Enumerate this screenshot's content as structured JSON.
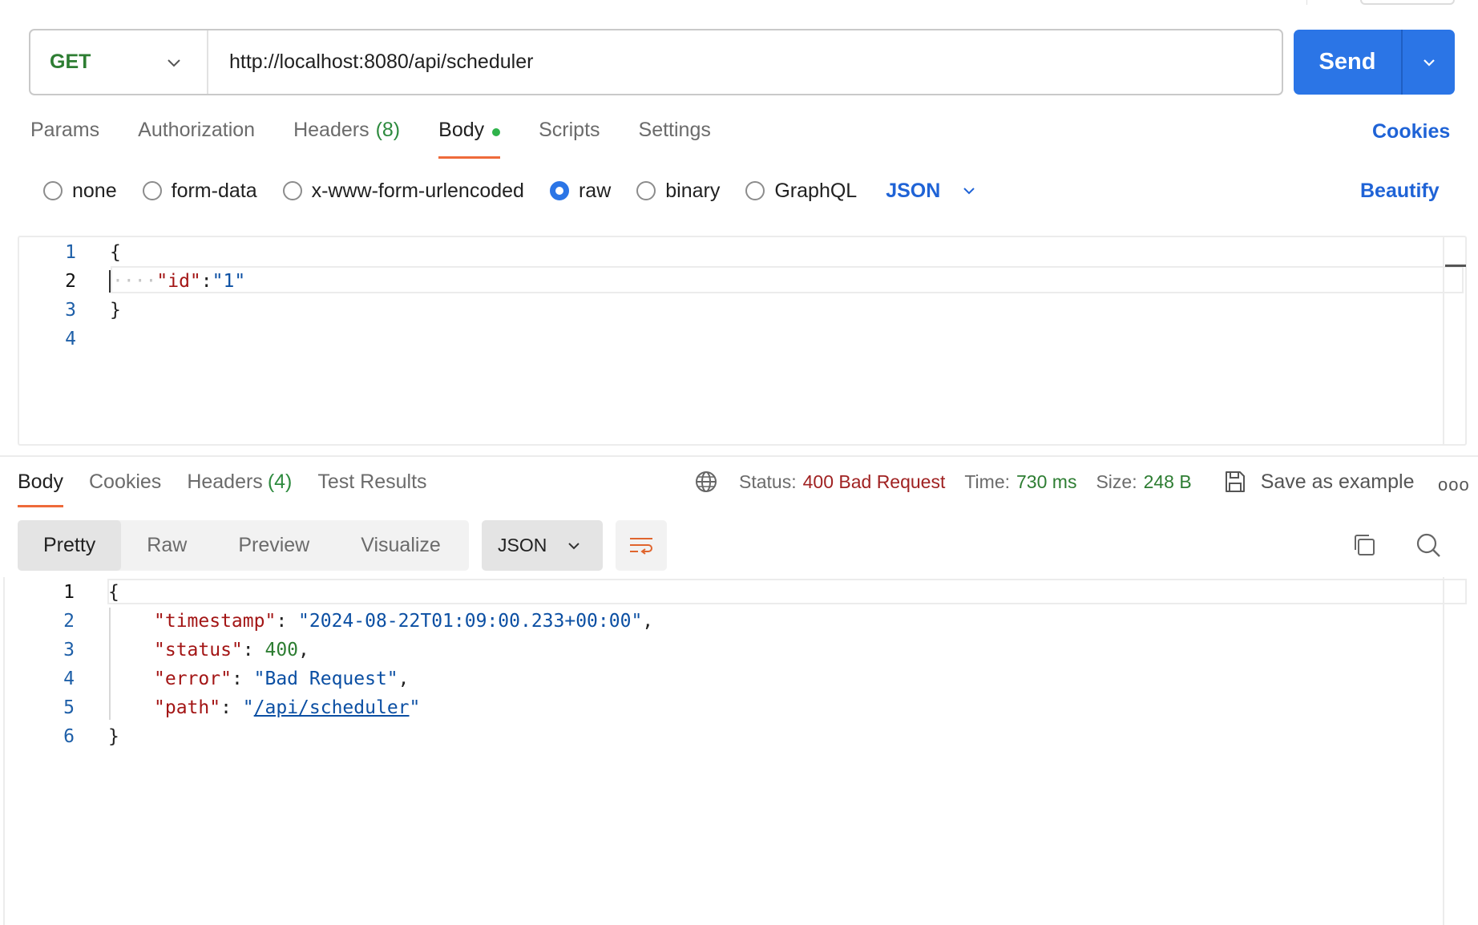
{
  "request": {
    "method": "GET",
    "url": "http://localhost:8080/api/scheduler",
    "send_label": "Send"
  },
  "request_tabs": [
    {
      "label": "Params"
    },
    {
      "label": "Authorization"
    },
    {
      "label": "Headers",
      "count": "(8)"
    },
    {
      "label": "Body",
      "active": true
    },
    {
      "label": "Scripts"
    },
    {
      "label": "Settings"
    }
  ],
  "cookies_label": "Cookies",
  "body_types": {
    "options": [
      "none",
      "form-data",
      "x-www-form-urlencoded",
      "raw",
      "binary",
      "GraphQL"
    ],
    "selected": "raw",
    "language": "JSON",
    "beautify_label": "Beautify"
  },
  "request_body": {
    "line_numbers": [
      "1",
      "2",
      "3",
      "4"
    ],
    "open_brace": "{",
    "ws": "····",
    "key": "\"id\"",
    "colon": ":",
    "value": "\"1\"",
    "close_brace": "}"
  },
  "response_tabs": [
    {
      "label": "Body",
      "active": true
    },
    {
      "label": "Cookies"
    },
    {
      "label": "Headers",
      "count": "(4)"
    },
    {
      "label": "Test Results"
    }
  ],
  "response_meta": {
    "status_label": "Status:",
    "status_value": "400 Bad Request",
    "time_label": "Time:",
    "time_value": "730 ms",
    "size_label": "Size:",
    "size_value": "248 B",
    "save_example_label": "Save as example",
    "more_label": "ooo"
  },
  "view_modes": [
    "Pretty",
    "Raw",
    "Preview",
    "Visualize"
  ],
  "view_mode_active": "Pretty",
  "response_language": "JSON",
  "response_body": {
    "line_numbers": [
      "1",
      "2",
      "3",
      "4",
      "5",
      "6"
    ],
    "open_brace": "{",
    "close_brace": "}",
    "lines": [
      {
        "key": "\"timestamp\"",
        "value": "\"2024-08-22T01:09:00.233+00:00\"",
        "type": "string",
        "trail": ","
      },
      {
        "key": "\"status\"",
        "value": "400",
        "type": "number",
        "trail": ","
      },
      {
        "key": "\"error\"",
        "value": "\"Bad Request\"",
        "type": "string",
        "trail": ","
      },
      {
        "key": "\"path\"",
        "value_quote": "\"",
        "value_link": "/api/scheduler",
        "type": "link",
        "trail": ""
      }
    ]
  },
  "colors": {
    "accent_blue": "#2b75e6",
    "method_green": "#2d7d32",
    "tab_underline": "#ee6a3a",
    "status_red": "#a02222"
  }
}
